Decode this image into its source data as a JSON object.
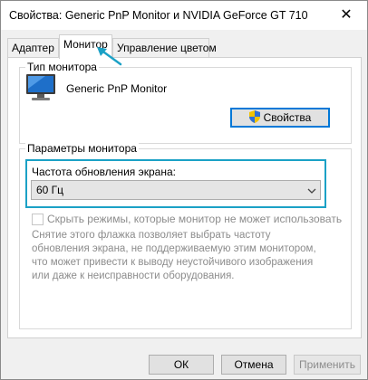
{
  "window": {
    "title": "Свойства: Generic PnP Monitor и NVIDIA GeForce GT 710",
    "close_glyph": "✕"
  },
  "tabs": [
    {
      "label": "Адаптер",
      "active": false
    },
    {
      "label": "Монитор",
      "active": true
    },
    {
      "label": "Управление цветом",
      "active": false
    }
  ],
  "monitor_type": {
    "group_label": "Тип монитора",
    "monitor_name": "Generic PnP Monitor",
    "monitor_icon": "monitor-icon",
    "properties_button": "Свойства",
    "properties_icon": "uac-shield-icon"
  },
  "monitor_settings": {
    "group_label": "Параметры монитора",
    "refresh_label": "Частота обновления экрана:",
    "refresh_value": "60 Гц",
    "hide_modes_label": "Скрыть режимы, которые монитор не может использовать",
    "hide_modes_checked": false,
    "note": "Снятие этого флажка позволяет выбрать частоту обновления экрана, не поддерживаемую этим монитором, что может привести к выводу неустойчивого изображения или даже к неисправности оборудования."
  },
  "buttons": {
    "ok": "ОК",
    "cancel": "Отмена",
    "apply": "Применить"
  },
  "colors": {
    "accent": "#0078d7",
    "highlight": "#1ba1c6",
    "disabled_text": "#8c8c8c"
  }
}
